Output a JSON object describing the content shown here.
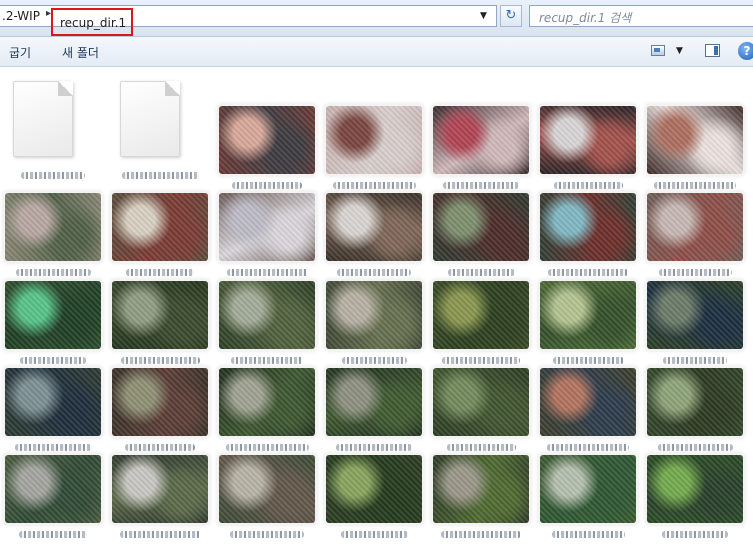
{
  "address_bar": {
    "previous_segment": ".2-WIP",
    "current_segment": "recup_dir.1",
    "separator": "▸",
    "dropdown_glyph": "▼"
  },
  "refresh": {
    "icon": "refresh-icon",
    "glyph": "↻"
  },
  "search": {
    "placeholder": "recup_dir.1 검색"
  },
  "command_bar": {
    "items": [
      {
        "label": "굽기"
      },
      {
        "label": "새 폴더"
      }
    ],
    "help_glyph": "?",
    "view_dropdown_glyph": "▼"
  },
  "thumbnails": [
    {
      "kind": "doc"
    },
    {
      "kind": "doc"
    },
    {
      "kind": "image",
      "colors": [
        "#6b3a36",
        "#d8a89a",
        "#3d3b41"
      ]
    },
    {
      "kind": "image",
      "colors": [
        "#c9b2b0",
        "#7a4640",
        "#d8cfcd"
      ]
    },
    {
      "kind": "image",
      "colors": [
        "#3a2a2e",
        "#b04454",
        "#d0b9ba"
      ]
    },
    {
      "kind": "image",
      "colors": [
        "#2a2326",
        "#d7d4d5",
        "#a3514b"
      ]
    },
    {
      "kind": "image",
      "colors": [
        "#3c2826",
        "#ad6f5f",
        "#ece2e0"
      ]
    },
    {
      "kind": "image",
      "colors": [
        "#8a8775",
        "#b8a7a2",
        "#506047"
      ]
    },
    {
      "kind": "image",
      "colors": [
        "#5a4d3c",
        "#d7d0c1",
        "#7b3b34"
      ]
    },
    {
      "kind": "image",
      "colors": [
        "#6c5c58",
        "#bdbbc6",
        "#dad6db"
      ]
    },
    {
      "kind": "image",
      "colors": [
        "#383028",
        "#d9d4d2",
        "#7f6758"
      ]
    },
    {
      "kind": "image",
      "colors": [
        "#2f3a30",
        "#7d8e6d",
        "#4d2d2a"
      ]
    },
    {
      "kind": "image",
      "colors": [
        "#2f3f35",
        "#7fb7c2",
        "#6d2f2a"
      ]
    },
    {
      "kind": "image",
      "colors": [
        "#6e5e58",
        "#c7b8b4",
        "#8e4e48"
      ]
    },
    {
      "kind": "image",
      "colors": [
        "#2f4d2d",
        "#57c288",
        "#1f3f24"
      ]
    },
    {
      "kind": "image",
      "colors": [
        "#26361f",
        "#8f9c83",
        "#3a4b2c"
      ]
    },
    {
      "kind": "image",
      "colors": [
        "#2d3f26",
        "#a2ab97",
        "#51623d"
      ]
    },
    {
      "kind": "image",
      "colors": [
        "#414a36",
        "#b7b0a3",
        "#66704e"
      ]
    },
    {
      "kind": "image",
      "colors": [
        "#3a4a24",
        "#89954f",
        "#2c3f1f"
      ]
    },
    {
      "kind": "image",
      "colors": [
        "#4e6a37",
        "#b3c28f",
        "#34502a"
      ]
    },
    {
      "kind": "image",
      "colors": [
        "#2c3f28",
        "#6b7a69",
        "#1c2f3f"
      ]
    },
    {
      "kind": "image",
      "colors": [
        "#2d3b32",
        "#7c8f92",
        "#1e2e3c"
      ]
    },
    {
      "kind": "image",
      "colors": [
        "#3a3229",
        "#8e8f74",
        "#5b3d35"
      ]
    },
    {
      "kind": "image",
      "colors": [
        "#23301f",
        "#9fa291",
        "#3d5730"
      ]
    },
    {
      "kind": "image",
      "colors": [
        "#243422",
        "#8e9080",
        "#3f5a30"
      ]
    },
    {
      "kind": "image",
      "colors": [
        "#2c3d24",
        "#738a5b",
        "#41552f"
      ]
    },
    {
      "kind": "image",
      "colors": [
        "#3e3f2c",
        "#b1735e",
        "#2c3b4b"
      ]
    },
    {
      "kind": "image",
      "colors": [
        "#33472b",
        "#8ea379",
        "#2c3a22"
      ]
    },
    {
      "kind": "image",
      "colors": [
        "#4b5b3f",
        "#a4a59f",
        "#2f4a35"
      ]
    },
    {
      "kind": "image",
      "colors": [
        "#323a2f",
        "#c8c6c2",
        "#5a6a48"
      ]
    },
    {
      "kind": "image",
      "colors": [
        "#3c4a35",
        "#b7b3a5",
        "#63574a"
      ]
    },
    {
      "kind": "image",
      "colors": [
        "#2c3b22",
        "#88a35c",
        "#233a1c"
      ]
    },
    {
      "kind": "image",
      "colors": [
        "#2f3b27",
        "#9a9688",
        "#4f6a31"
      ]
    },
    {
      "kind": "image",
      "colors": [
        "#3c5a30",
        "#b5bfae",
        "#2d5732"
      ]
    },
    {
      "kind": "image",
      "colors": [
        "#2b4b25",
        "#73a94c",
        "#28402a"
      ]
    }
  ]
}
